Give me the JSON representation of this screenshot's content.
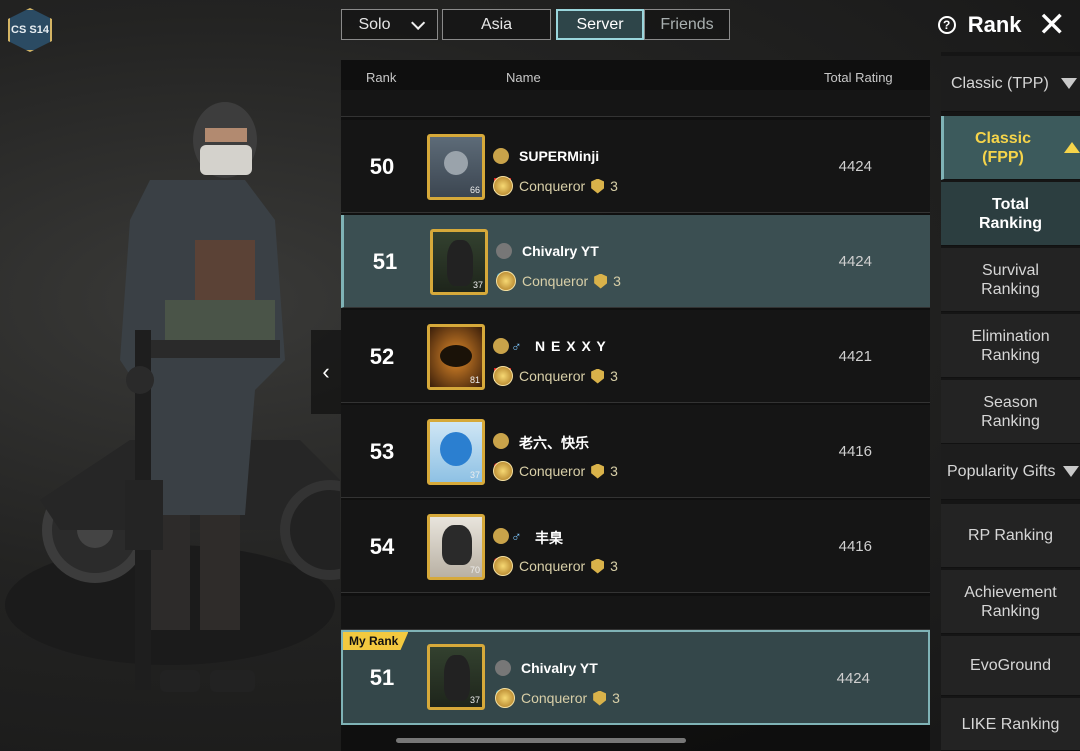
{
  "season_badge": "CS S14",
  "top_tabs": {
    "mode": "Solo",
    "region": "Asia",
    "server": "Server",
    "friends": "Friends"
  },
  "header": {
    "help_icon": "?",
    "title": "Rank",
    "close": "✕"
  },
  "columns": {
    "rank": "Rank",
    "name": "Name",
    "rating": "Total Rating"
  },
  "rows": [
    {
      "rank": "50",
      "name": "SUPERMinji",
      "tier": "Conqueror",
      "stars": "3",
      "rating": "4424",
      "level": "66",
      "flag": "indonesia",
      "gender": ""
    },
    {
      "rank": "51",
      "name": "Chivalry YT",
      "tier": "Conqueror",
      "stars": "3",
      "rating": "4424",
      "level": "37",
      "flag": "kazakhstan",
      "gender": ""
    },
    {
      "rank": "52",
      "name": "N E X X Y",
      "tier": "Conqueror",
      "stars": "3",
      "rating": "4421",
      "level": "81",
      "flag": "indonesia",
      "gender": "♂"
    },
    {
      "rank": "53",
      "name": "老六、快乐",
      "tier": "Conqueror",
      "stars": "3",
      "rating": "4416",
      "level": "37",
      "flag": "china",
      "gender": ""
    },
    {
      "rank": "54",
      "name": "丰臬",
      "tier": "Conqueror",
      "stars": "3",
      "rating": "4416",
      "level": "70",
      "flag": "china",
      "gender": "♂"
    }
  ],
  "my_rank": {
    "label": "My Rank",
    "rank": "51",
    "name": "Chivalry YT",
    "tier": "Conqueror",
    "stars": "3",
    "rating": "4424",
    "level": "37"
  },
  "side_menu": {
    "classic_tpp": "Classic (TPP)",
    "classic_fpp": "Classic (FPP)",
    "total": "Total Ranking",
    "survival": "Survival Ranking",
    "elimination": "Elimination Ranking",
    "season": "Season Ranking",
    "popularity": "Popularity Gifts",
    "rp": "RP Ranking",
    "achievement": "Achievement Ranking",
    "evoground": "EvoGround",
    "like": "LIKE Ranking"
  },
  "colors": {
    "accent": "#f6d44a",
    "selected_row": "#3b4f52",
    "frame_gold": "#d6a93a"
  }
}
